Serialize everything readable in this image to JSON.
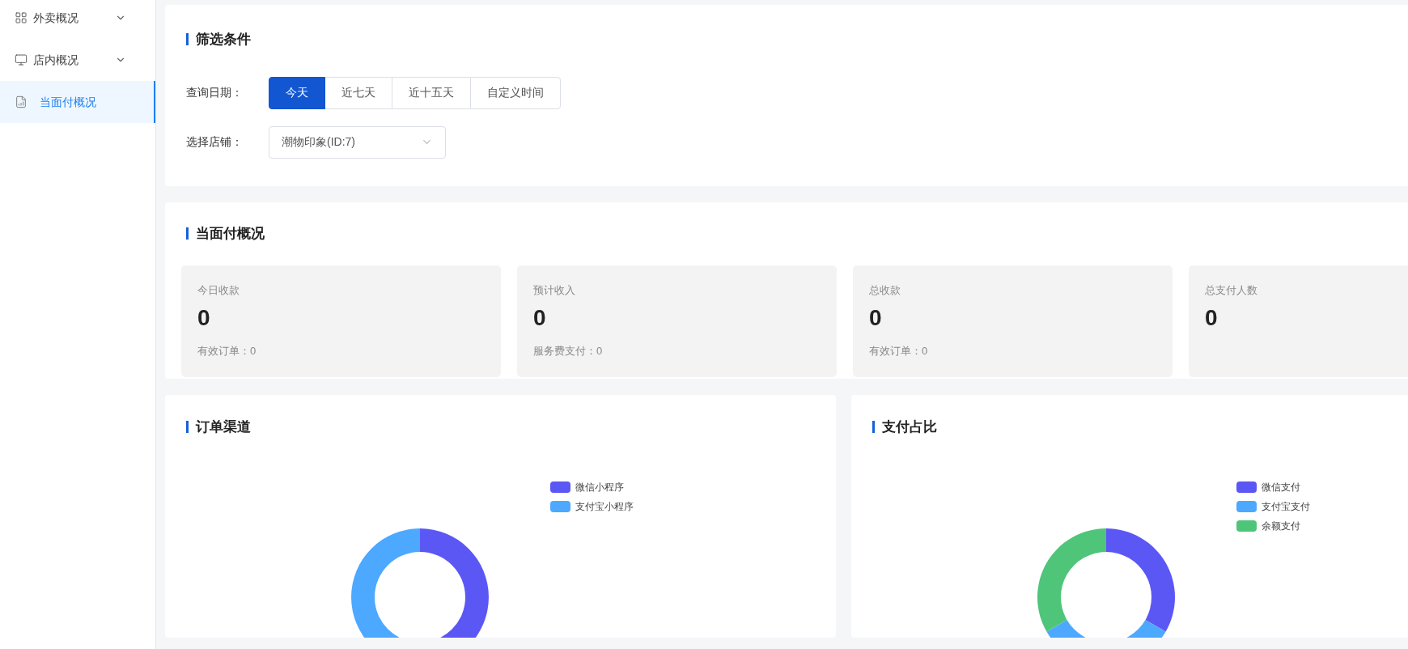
{
  "sidebar": {
    "items": [
      {
        "label": "外卖概况",
        "kind": "group",
        "expanded": false,
        "selected": false
      },
      {
        "label": "店内概况",
        "kind": "group",
        "expanded": false,
        "selected": false
      },
      {
        "label": "当面付概况",
        "kind": "link",
        "selected": true
      }
    ]
  },
  "filter": {
    "title": "筛选条件",
    "date_label": "查询日期：",
    "date_options": [
      {
        "label": "今天",
        "selected": true
      },
      {
        "label": "近七天",
        "selected": false
      },
      {
        "label": "近十五天",
        "selected": false
      },
      {
        "label": "自定义时间",
        "selected": false
      }
    ],
    "store_label": "选择店铺：",
    "store_select": {
      "value": "潮物印象(ID:7)"
    }
  },
  "overview": {
    "title": "当面付概况",
    "stats": [
      {
        "label": "今日收款",
        "value": "0",
        "note": "有效订单：0"
      },
      {
        "label": "预计收入",
        "value": "0",
        "note": "服务费支付：0"
      },
      {
        "label": "总收款",
        "value": "0",
        "note": "有效订单：0"
      },
      {
        "label": "总支付人数",
        "value": "0"
      }
    ]
  },
  "charts": [
    {
      "title": "订单渠道",
      "legend": [
        {
          "label": "微信小程序",
          "color": "#5b57f5"
        },
        {
          "label": "支付宝小程序",
          "color": "#4da8ff"
        }
      ]
    },
    {
      "title": "支付占比",
      "legend": [
        {
          "label": "微信支付",
          "color": "#5b57f5"
        },
        {
          "label": "支付宝支付",
          "color": "#4da8ff"
        },
        {
          "label": "余额支付",
          "color": "#4fc57a"
        }
      ]
    }
  ]
}
